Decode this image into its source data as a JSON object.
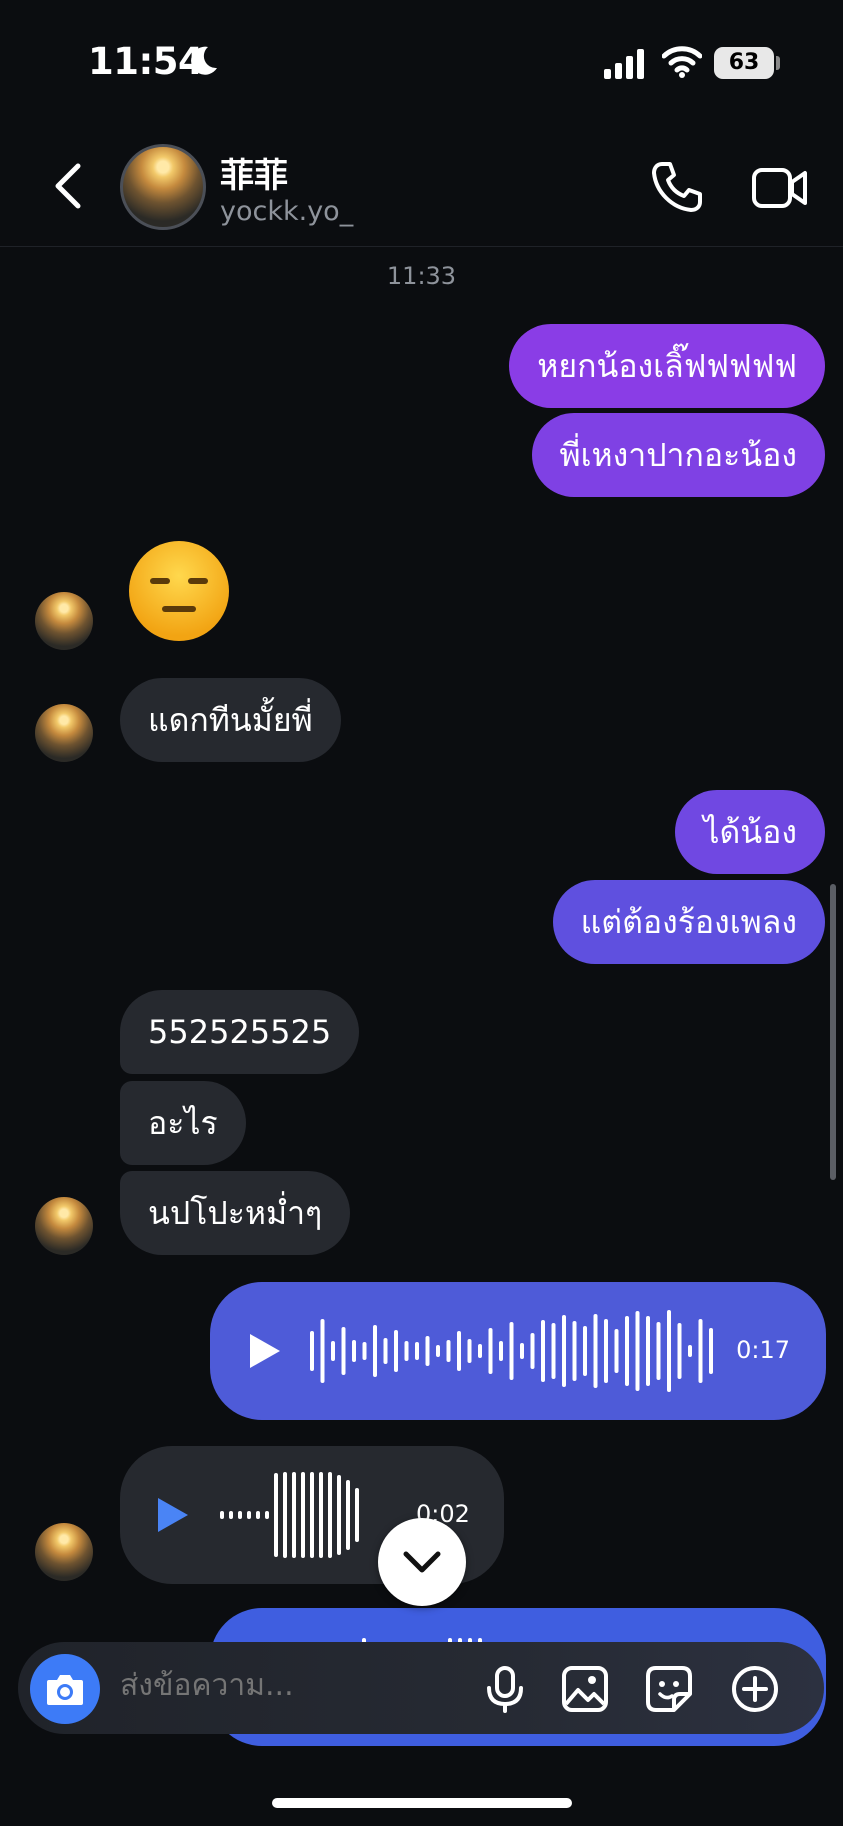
{
  "status_bar": {
    "time": "11:54",
    "battery": "63"
  },
  "header": {
    "name": "菲菲",
    "username": "yockk.yo_"
  },
  "timestamp": "11:33",
  "messages": {
    "out1": "หยกน้องเลิ๊ฟฟฟฟฟ",
    "out2": "พี่เหงาปากอะน้อง",
    "emoji": "😑",
    "in1": "แดกทีนมั้ยพี่",
    "out3": "ได้น้อง",
    "out4": "แต่ต้องร้องเพลง",
    "in2": "552525525",
    "in3": "อะไร",
    "in4": "นปโปะหม่ำๆ"
  },
  "voice": {
    "out_duration": "0:17",
    "in_duration": "0:02"
  },
  "composer": {
    "placeholder": "ส่งข้อความ..."
  },
  "colors": {
    "out_top": "#8b3ee6",
    "out_mid": "#6a4ddc",
    "voice_out": "#4e5bd8",
    "incoming": "#26292f",
    "accent": "#3d7bf7"
  }
}
